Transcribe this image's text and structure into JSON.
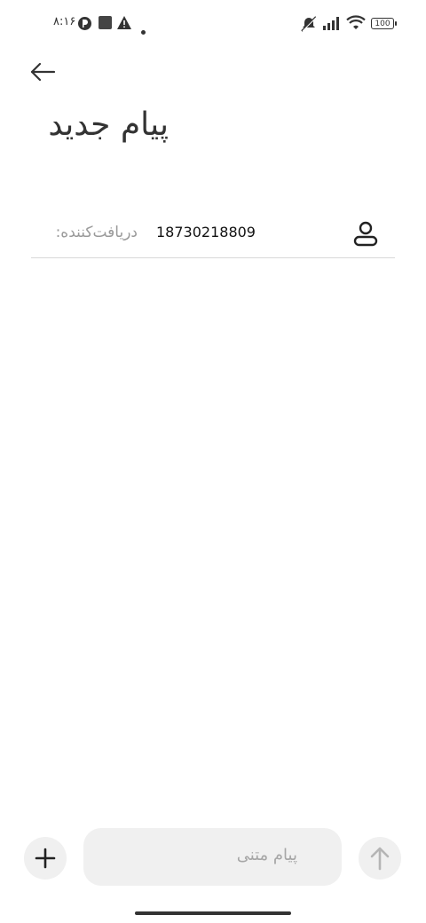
{
  "status_bar": {
    "time": "۸:۱۶",
    "battery": "100",
    "left_icons": [
      "app-notification-icon",
      "square-icon",
      "warning-icon",
      "dot-icon"
    ],
    "right_icons": [
      "mute-icon",
      "signal-icon",
      "wifi-icon",
      "battery-icon"
    ]
  },
  "header": {
    "back_icon": "back-arrow-icon",
    "title": "پیام جدید"
  },
  "recipient": {
    "label": "دریافت‌کننده:",
    "number": "18730218809",
    "contact_icon": "contact-icon"
  },
  "composer": {
    "placeholder": "پیام متنی",
    "attach_icon": "plus-icon",
    "send_icon": "send-arrow-icon"
  }
}
